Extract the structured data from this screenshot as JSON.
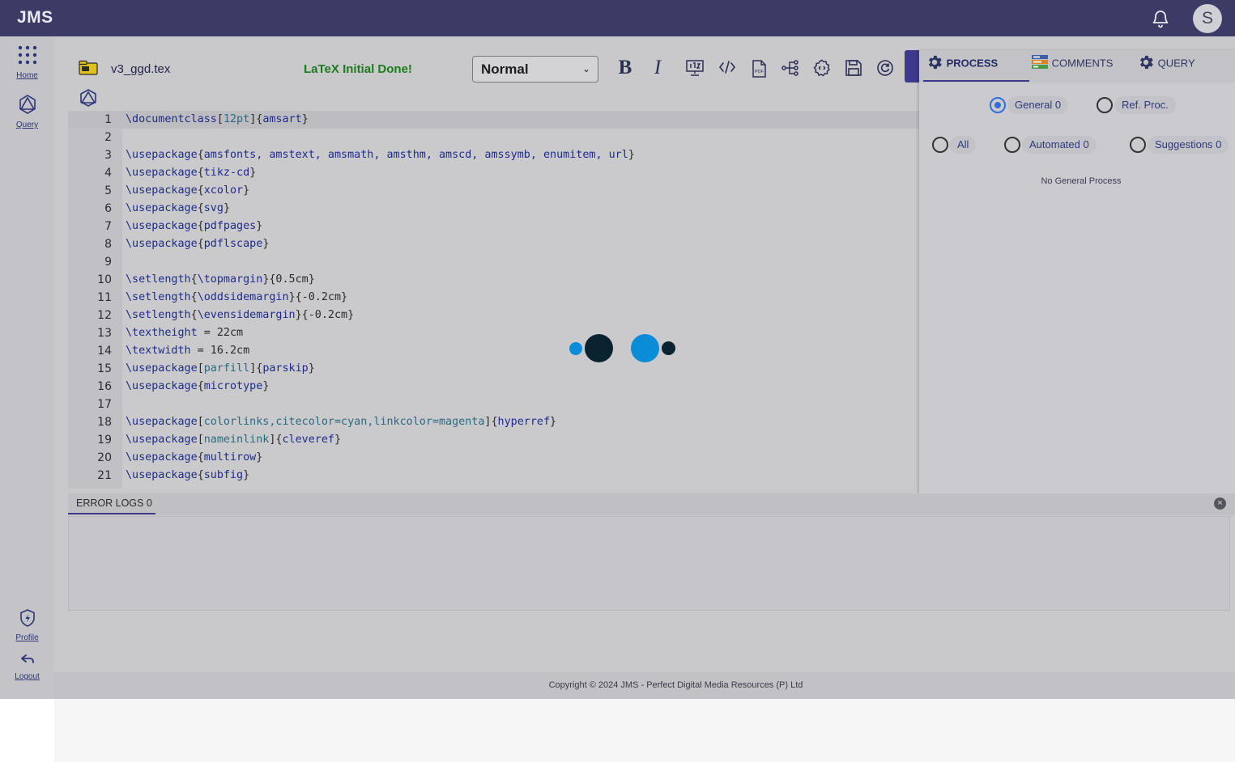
{
  "header": {
    "logo": "JMS",
    "avatar_initial": "S"
  },
  "sidebar": {
    "items": [
      {
        "label": "Home"
      },
      {
        "label": "Query"
      },
      {
        "label": "Profile"
      },
      {
        "label": "Logout"
      }
    ]
  },
  "toolbar": {
    "filename": "v3_ggd.tex",
    "status": "LaTeX Initial Done!",
    "style_select": "Normal",
    "bold_label": "B",
    "italic_label": "I"
  },
  "editor": {
    "lines": [
      {
        "n": "1"
      },
      {
        "n": "2"
      },
      {
        "n": "3"
      },
      {
        "n": "4"
      },
      {
        "n": "5"
      },
      {
        "n": "6"
      },
      {
        "n": "7"
      },
      {
        "n": "8"
      },
      {
        "n": "9"
      },
      {
        "n": "10"
      },
      {
        "n": "11"
      },
      {
        "n": "12"
      },
      {
        "n": "13"
      },
      {
        "n": "14"
      },
      {
        "n": "15"
      },
      {
        "n": "16"
      },
      {
        "n": "17"
      },
      {
        "n": "18"
      },
      {
        "n": "19"
      },
      {
        "n": "20"
      },
      {
        "n": "21"
      }
    ],
    "tokens": {
      "l1a": "\\documentclass",
      "l1b": "[",
      "l1c": "12pt",
      "l1d": "]{",
      "l1e": "amsart",
      "l1f": "}",
      "l3a": "\\usepackage",
      "l3b": "{",
      "l3c": "amsfonts, amstext, amsmath, amsthm, amscd, amssymb, enumitem, url",
      "l3d": "}",
      "l4a": "\\usepackage",
      "l4b": "{",
      "l4c": "tikz-cd",
      "l4d": "}",
      "l5a": "\\usepackage",
      "l5b": "{",
      "l5c": "xcolor",
      "l5d": "}",
      "l6a": "\\usepackage",
      "l6b": "{",
      "l6c": "svg",
      "l6d": "}",
      "l7a": "\\usepackage",
      "l7b": "{",
      "l7c": "pdfpages",
      "l7d": "}",
      "l8a": "\\usepackage",
      "l8b": "{",
      "l8c": "pdflscape",
      "l8d": "}",
      "l10a": "\\setlength",
      "l10b": "{",
      "l10c": "\\topmargin",
      "l10d": "}{0.5cm}",
      "l11a": "\\setlength",
      "l11b": "{",
      "l11c": "\\oddsidemargin",
      "l11d": "}{-0.2cm}",
      "l12a": "\\setlength",
      "l12b": "{",
      "l12c": "\\evensidemargin",
      "l12d": "}{-0.2cm}",
      "l13a": "\\textheight",
      "l13b": " = 22cm",
      "l14a": "\\textwidth",
      "l14b": " = 16.2cm",
      "l15a": "\\usepackage",
      "l15b": "[",
      "l15c": "parfill",
      "l15d": "]{",
      "l15e": "parskip",
      "l15f": "}",
      "l16a": "\\usepackage",
      "l16b": "{",
      "l16c": "microtype",
      "l16d": "}",
      "l18a": "\\usepackage",
      "l18b": "[",
      "l18c": "colorlinks,citecolor=cyan,linkcolor=magenta",
      "l18d": "]{",
      "l18e": "hyperref",
      "l18f": "}",
      "l19a": "\\usepackage",
      "l19b": "[",
      "l19c": "nameinlink",
      "l19d": "]{",
      "l19e": "cleveref",
      "l19f": "}",
      "l20a": "\\usepackage",
      "l20b": "{",
      "l20c": "multirow",
      "l20d": "}",
      "l21a": "\\usepackage",
      "l21b": "{",
      "l21c": "subfig",
      "l21d": "}"
    }
  },
  "panel": {
    "tabs": [
      {
        "label": "PROCESS"
      },
      {
        "label": "COMMENTS"
      },
      {
        "label": "QUERY"
      }
    ],
    "scope_options": [
      {
        "label": "General 0"
      },
      {
        "label": "Ref. Proc."
      }
    ],
    "filter_options": [
      {
        "label": "All"
      },
      {
        "label": "Automated 0"
      },
      {
        "label": "Suggestions 0"
      }
    ],
    "empty_message": "No General Process"
  },
  "error_logs": {
    "tab_label": "ERROR LOGS 0",
    "close_label": "×"
  },
  "footer": {
    "copyright": "Copyright © 2024 JMS - Perfect Digital Media Resources (P) Ltd"
  },
  "colors": {
    "topbar": "#3b3b66",
    "accent": "#3d3a8c",
    "status_green": "#1d7a1d",
    "spinner_blue": "#0a8cd8",
    "spinner_dark": "#0a2330"
  }
}
